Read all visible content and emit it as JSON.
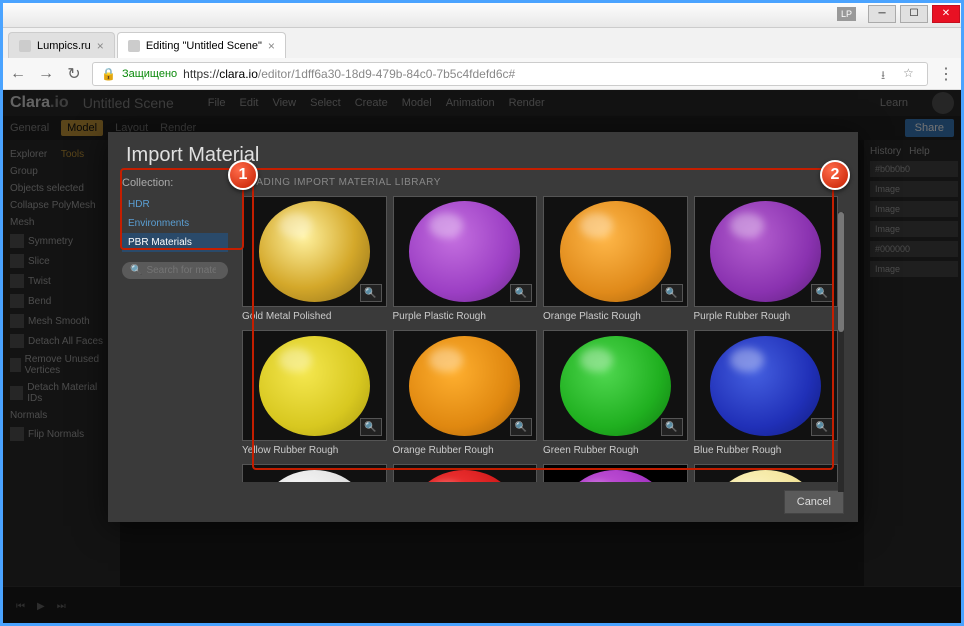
{
  "titlebar": {
    "lp": "LP"
  },
  "tabs": [
    {
      "label": "Lumpics.ru"
    },
    {
      "label": "Editing \"Untitled Scene\""
    }
  ],
  "addressbar": {
    "secure": "Защищено",
    "protocol": "https://",
    "domain": "clara.io",
    "path": "/editor/1dff6a30-18d9-479b-84c0-7b5c4fdefd6c#"
  },
  "app": {
    "logo": "Clara",
    "logo_suffix": ".io",
    "scene": "Untitled Scene",
    "menus": [
      "File",
      "Edit",
      "View",
      "Select",
      "Create",
      "Model",
      "Animation",
      "Render"
    ],
    "learn": "Learn",
    "toolbar": {
      "general": "General",
      "model": "Model",
      "layout": "Layout",
      "render": "Render",
      "share": "Share"
    },
    "left_tabs": {
      "explorer": "Explorer",
      "tools": "Tools"
    },
    "left_items": [
      "Group",
      "Objects selected",
      "Collapse PolyMesh",
      "Mesh",
      "Symmetry",
      "Slice",
      "Twist",
      "Bend",
      "Mesh Smooth",
      "Detach All Faces",
      "Remove Unused Vertices",
      "Detach Material IDs",
      "Normals",
      "Flip Normals"
    ],
    "right_tabs": {
      "history": "History",
      "help": "Help"
    },
    "right_items": [
      "#b0b0b0",
      "Image",
      "Image",
      "Image",
      "#000000",
      "Image"
    ]
  },
  "modal": {
    "title": "Import Material",
    "collection_label": "Collection:",
    "collections": [
      {
        "name": "HDR"
      },
      {
        "name": "Environments"
      },
      {
        "name": "PBR Materials"
      }
    ],
    "search_placeholder": "Search for materia",
    "loading": "LOADING IMPORT MATERIAL LIBRARY",
    "materials": [
      {
        "name": "Gold Metal Polished",
        "color": "radial-gradient(circle at 40% 35%, #fff2a0, #d4a82a 55%, #8a6b18)"
      },
      {
        "name": "Purple Plastic Rough",
        "color": "radial-gradient(circle at 40% 35%, #c570e0, #9c3fc4 60%, #6a2a88)"
      },
      {
        "name": "Orange Plastic Rough",
        "color": "radial-gradient(circle at 40% 35%, #ffb84a, #e08a1a 60%, #a05f0a)"
      },
      {
        "name": "Purple Rubber Rough",
        "color": "radial-gradient(circle at 40% 35%, #b560d0, #8a32b0 60%, #5a1f78)"
      },
      {
        "name": "Yellow Rubber Rough",
        "color": "radial-gradient(circle at 40% 35%, #f5e850, #d8c820 60%, #a89810)"
      },
      {
        "name": "Orange Rubber Rough",
        "color": "radial-gradient(circle at 40% 35%, #ffb030, #e08810 60%, #a05e08)"
      },
      {
        "name": "Green Rubber Rough",
        "color": "radial-gradient(circle at 40% 35%, #50d850, #20b020 60%, #107810)"
      },
      {
        "name": "Blue Rubber Rough",
        "color": "radial-gradient(circle at 40% 35%, #4560e0, #2030b8 60%, #101a78)"
      },
      {
        "name": "",
        "color": "radial-gradient(circle at 40% 35%, #fff, #ddd 60%, #aaa)"
      },
      {
        "name": "",
        "color": "radial-gradient(circle at 40% 35%, #ff4040, #d01818 60%, #900808)"
      },
      {
        "name": "",
        "color": "radial-gradient(circle at 40% 35%, #d060e0, #a030c0 60%, #6a1888)",
        "bg": "#000"
      },
      {
        "name": "",
        "color": "radial-gradient(circle at 40% 35%, #fffad0, #f0e090 60%, #c8b050)"
      }
    ],
    "cancel": "Cancel"
  },
  "callouts": {
    "one": "1",
    "two": "2"
  }
}
